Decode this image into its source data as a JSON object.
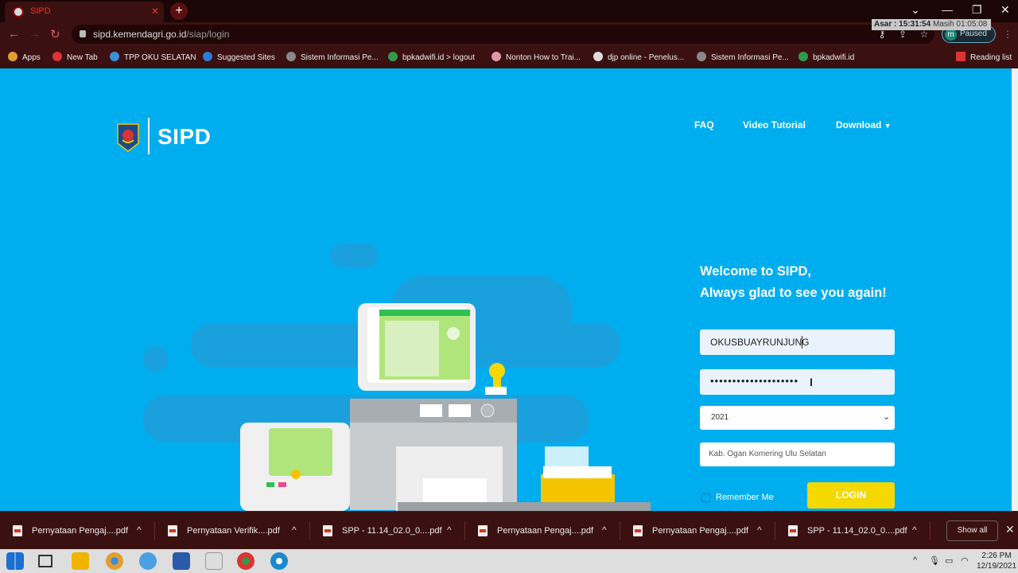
{
  "browser": {
    "tab_title": "SIPD",
    "url_domain": "sipd.kemendagri.go.id",
    "url_path": "/siap/login",
    "ext_overlay_prefix": "Asar :",
    "ext_overlay_time": "15:31:54",
    "ext_overlay_suffix": "Masih 01:05:08",
    "profile_initial": "m",
    "profile_status": "Paused"
  },
  "bookmarks": [
    {
      "label": "Apps",
      "color": "#e0a030"
    },
    {
      "label": "New Tab",
      "color": "#d33"
    },
    {
      "label": "TPP OKU SELATAN",
      "color": "#3a8fd8"
    },
    {
      "label": "Suggested Sites",
      "color": "#2b7cd3"
    },
    {
      "label": "Sistem Informasi Pe...",
      "color": "#888"
    },
    {
      "label": "bpkadwifi.id > logout",
      "color": "#2e9a4a"
    },
    {
      "label": "Nonton How to Trai...",
      "color": "#d9a"
    },
    {
      "label": "djp online - Penelus...",
      "color": "#ddd"
    },
    {
      "label": "Sistem Informasi Pe...",
      "color": "#888"
    },
    {
      "label": "bpkadwifi.id",
      "color": "#2e9a4a"
    }
  ],
  "reading_list": "Reading list",
  "site": {
    "brand": "SIPD",
    "nav": [
      "FAQ",
      "Video Tutorial",
      "Download"
    ],
    "welcome_line1": "Welcome to SIPD,",
    "welcome_line2": "Always glad to see you again!"
  },
  "login_form": {
    "username_value": "OKUSBUAYRUNJUNG",
    "password_mask": "••••••••••••••••••••",
    "year_selected": "2021",
    "region_value": "Kab. Ogan Komering Ulu Selatan",
    "remember_label": "Remember Me",
    "login_label": "LOGIN"
  },
  "downloads": [
    "Pernyataan Pengaj....pdf",
    "Pernyataan Verifik....pdf",
    "SPP - 11.14_02.0_0....pdf",
    "Pernyataan Pengaj....pdf",
    "Pernyataan Pengaj....pdf",
    "SPP - 11.14_02.0_0....pdf"
  ],
  "show_all": "Show all",
  "taskbar": {
    "time": "2:26 PM",
    "date": "12/19/2021"
  },
  "colors": {
    "page_bg": "#00aeef",
    "login_button": "#f5d800",
    "browser_chrome": "#3a1010"
  }
}
